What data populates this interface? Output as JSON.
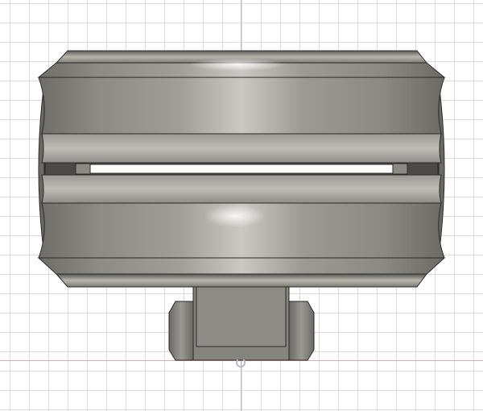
{
  "viewport": {
    "grid": true,
    "background": "#ffffff",
    "grid_color": "#dcdcdc",
    "axis_colors": {
      "vertical": "#b8b8e8",
      "horizontal": "#e8a8a8"
    }
  },
  "model": {
    "part": "roller-wheel-with-hub",
    "view": "front",
    "material_color": "#8f8d86",
    "highlight_color": "#e6e6e0",
    "edge_color": "#2a2a2a"
  }
}
